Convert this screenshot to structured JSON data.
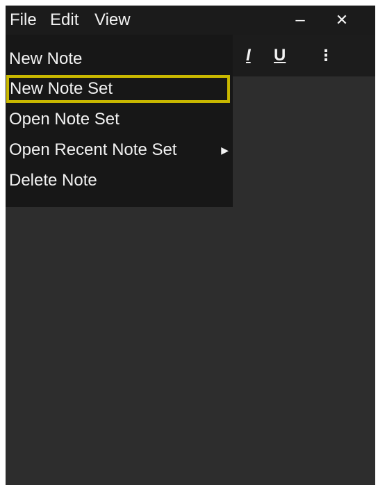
{
  "menubar": {
    "file": "File",
    "edit": "Edit",
    "view": "View"
  },
  "window_controls": {
    "minimize": "–",
    "close": "✕"
  },
  "toolbar": {
    "italic": "I",
    "underline": "U",
    "more": "⋮"
  },
  "file_menu": {
    "items": [
      {
        "label": "New Note"
      },
      {
        "label": "New Note Set"
      },
      {
        "label": "Open Note Set"
      },
      {
        "label": "Open Recent Note Set"
      },
      {
        "label": "Delete Note"
      }
    ],
    "submenu_arrow": "▶",
    "highlighted_item": "New Note Set"
  },
  "colors": {
    "highlight_outline": "#c9b800",
    "menu_bg": "#171717",
    "content_bg": "#2d2d2d"
  }
}
